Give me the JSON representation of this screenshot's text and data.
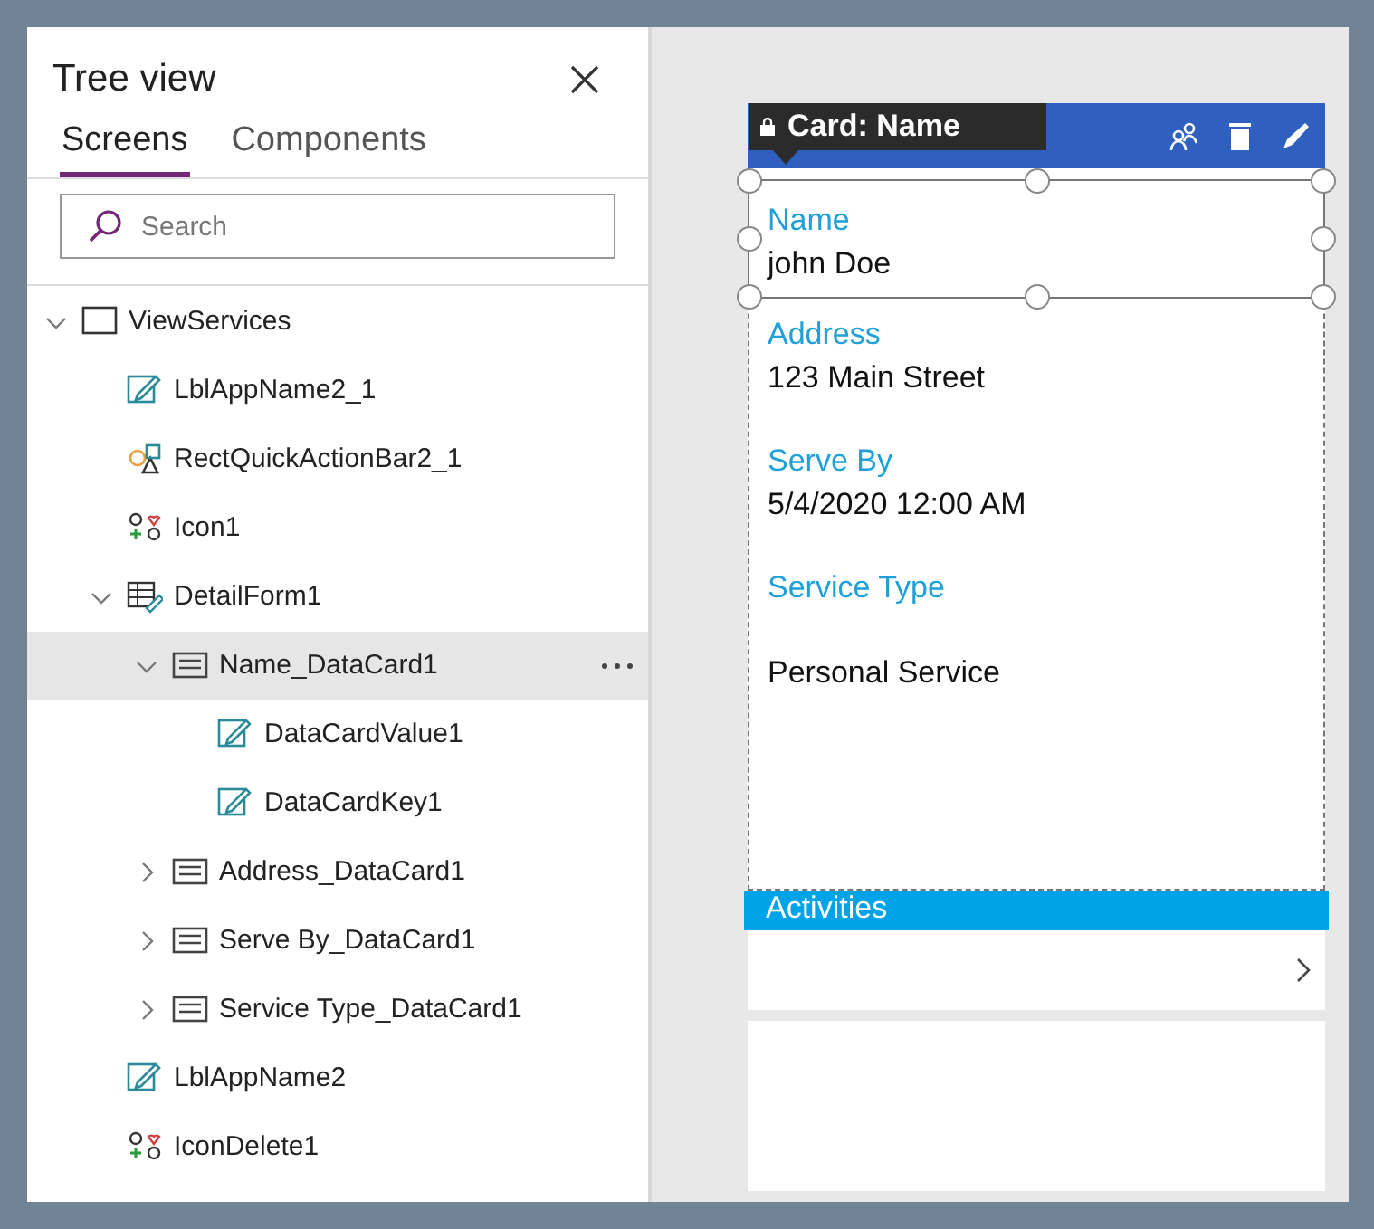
{
  "panel": {
    "title": "Tree view",
    "tabs": [
      {
        "label": "Screens",
        "selected": true
      },
      {
        "label": "Components",
        "selected": false
      }
    ],
    "search": {
      "placeholder": "Search"
    }
  },
  "tree": [
    {
      "kind": "screen",
      "label": "ViewServices",
      "expanded": true,
      "selected": false,
      "children": [
        {
          "kind": "label",
          "label": "LblAppName2_1",
          "selected": false
        },
        {
          "kind": "shape",
          "label": "RectQuickActionBar2_1",
          "selected": false
        },
        {
          "kind": "icon",
          "label": "Icon1",
          "selected": false
        },
        {
          "kind": "form",
          "label": "DetailForm1",
          "expanded": true,
          "selected": false,
          "children": [
            {
              "kind": "card",
              "label": "Name_DataCard1",
              "expanded": true,
              "selected": true,
              "children": [
                {
                  "kind": "label",
                  "label": "DataCardValue1",
                  "selected": false
                },
                {
                  "kind": "label",
                  "label": "DataCardKey1",
                  "selected": false
                }
              ]
            },
            {
              "kind": "card",
              "label": "Address_DataCard1",
              "expanded": false,
              "selected": false
            },
            {
              "kind": "card",
              "label": "Serve By_DataCard1",
              "expanded": false,
              "selected": false
            },
            {
              "kind": "card",
              "label": "Service Type_DataCard1",
              "expanded": false,
              "selected": false
            }
          ]
        },
        {
          "kind": "label",
          "label": "LblAppName2",
          "selected": false
        },
        {
          "kind": "icon",
          "label": "IconDelete1",
          "selected": false
        }
      ]
    }
  ],
  "canvas": {
    "tooltip": "Card: Name",
    "fields": [
      {
        "kind": "single",
        "label": "Name",
        "value": "john Doe",
        "selected": true
      },
      {
        "kind": "single",
        "label": "Address",
        "value": "123 Main Street",
        "selected": false
      },
      {
        "kind": "single",
        "label": "Serve By",
        "value": "5/4/2020 12:00 AM",
        "selected": false
      },
      {
        "kind": "multiline",
        "label": "Service Type",
        "value": "Personal Service",
        "selected": false
      }
    ],
    "section_header": "Activities"
  }
}
